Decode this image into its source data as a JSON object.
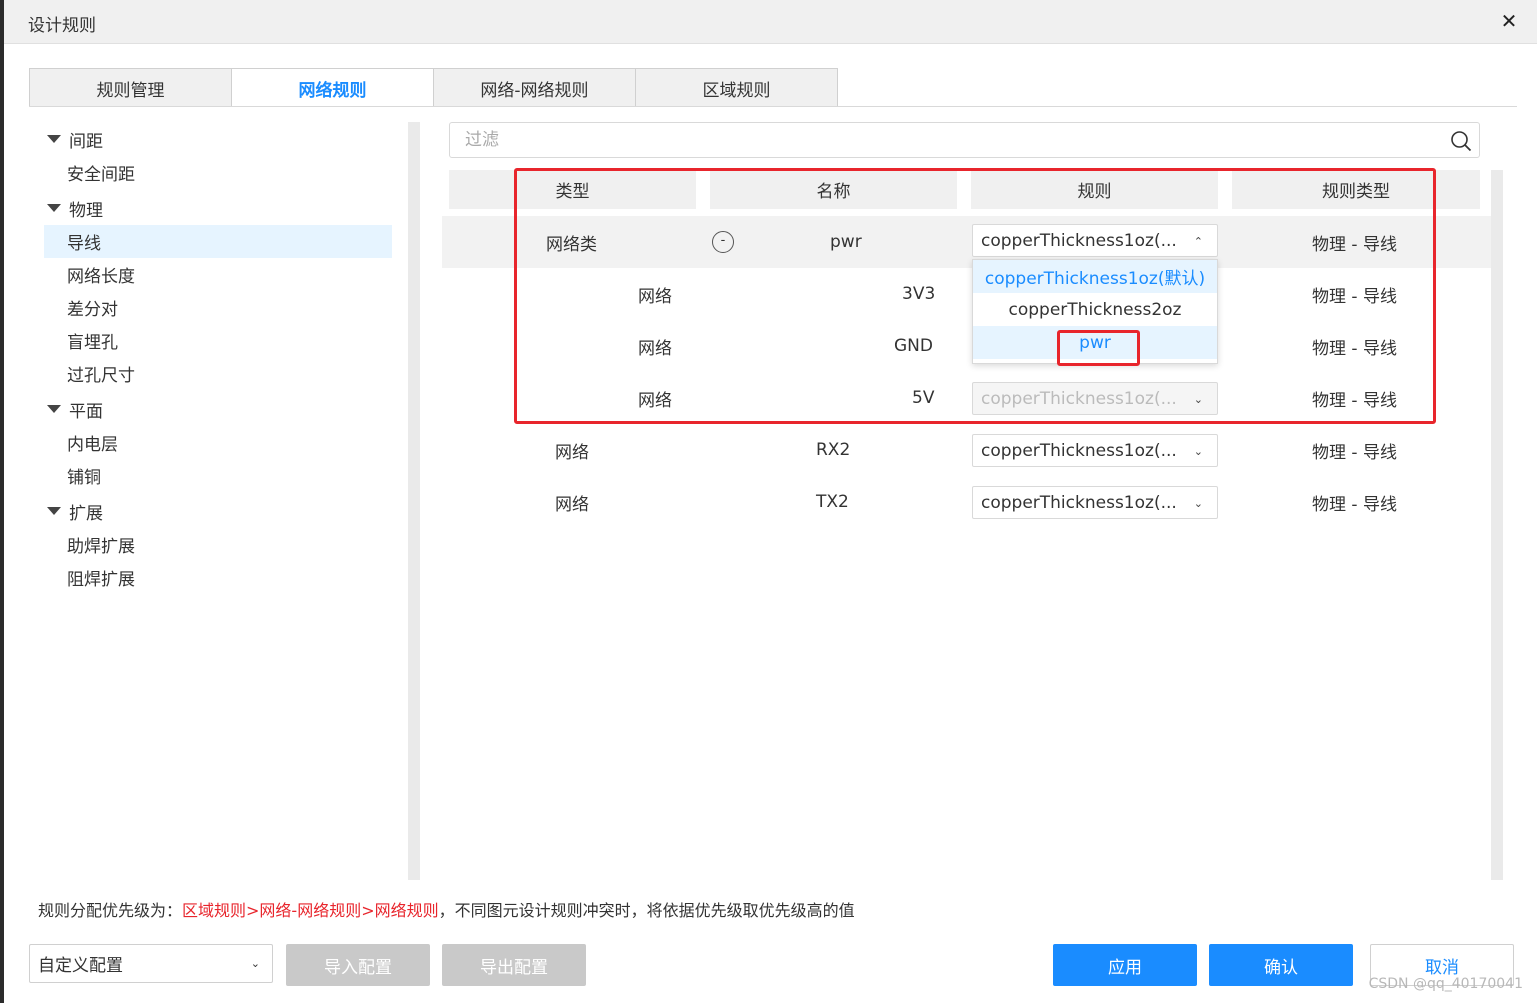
{
  "window": {
    "title": "设计规则",
    "close_symbol": "✕"
  },
  "tabs": [
    {
      "label": "规则管理",
      "active": false
    },
    {
      "label": "网络规则",
      "active": true
    },
    {
      "label": "网络-网络规则",
      "active": false
    },
    {
      "label": "区域规则",
      "active": false
    }
  ],
  "tree": {
    "groups": [
      {
        "label": "间距",
        "items": [
          "安全间距"
        ]
      },
      {
        "label": "物理",
        "items": [
          "导线",
          "网络长度",
          "差分对",
          "盲埋孔",
          "过孔尺寸"
        ]
      },
      {
        "label": "平面",
        "items": [
          "内电层",
          "铺铜"
        ]
      },
      {
        "label": "扩展",
        "items": [
          "助焊扩展",
          "阻焊扩展"
        ]
      }
    ],
    "selected": "导线"
  },
  "filter": {
    "placeholder": "过滤",
    "value": ""
  },
  "table": {
    "headers": [
      "类型",
      "名称",
      "规则",
      "规则类型"
    ],
    "rows": [
      {
        "type": "网络类",
        "name": "pwr",
        "rule": "copperThickness1oz(...",
        "rule_type": "物理 - 导线",
        "collapse_symbol": "-",
        "highlighted": true,
        "dropdown_open": true
      },
      {
        "type": "网络",
        "name": "3V3",
        "rule": "",
        "rule_type": "物理 - 导线"
      },
      {
        "type": "网络",
        "name": "GND",
        "rule": "",
        "rule_type": "物理 - 导线"
      },
      {
        "type": "网络",
        "name": "5V",
        "rule": "copperThickness1oz(...",
        "rule_type": "物理 - 导线",
        "disabled": true
      },
      {
        "type": "网络",
        "name": "RX2",
        "rule": "copperThickness1oz(...",
        "rule_type": "物理 - 导线"
      },
      {
        "type": "网络",
        "name": "TX2",
        "rule": "copperThickness1oz(...",
        "rule_type": "物理 - 导线"
      }
    ]
  },
  "dropdown": {
    "options": [
      "copperThickness1oz(默认)",
      "copperThickness2oz",
      "pwr"
    ],
    "selected": "copperThickness1oz(默认)",
    "hovered": "pwr"
  },
  "footer": {
    "note_prefix": "规则分配优先级为：",
    "note_highlight": "区域规则>网络-网络规则>网络规则",
    "note_suffix": "，不同图元设计规则冲突时，将依据优先级取优先级高的值",
    "config_select": "自定义配置",
    "import_label": "导入配置",
    "export_label": "导出配置",
    "apply_label": "应用",
    "confirm_label": "确认",
    "cancel_label": "取消"
  },
  "watermark": "CSDN @qq_40170041",
  "colors": {
    "accent": "#1a8cff",
    "highlight_box": "#e8252c",
    "selected_bg": "#e6f4ff"
  }
}
